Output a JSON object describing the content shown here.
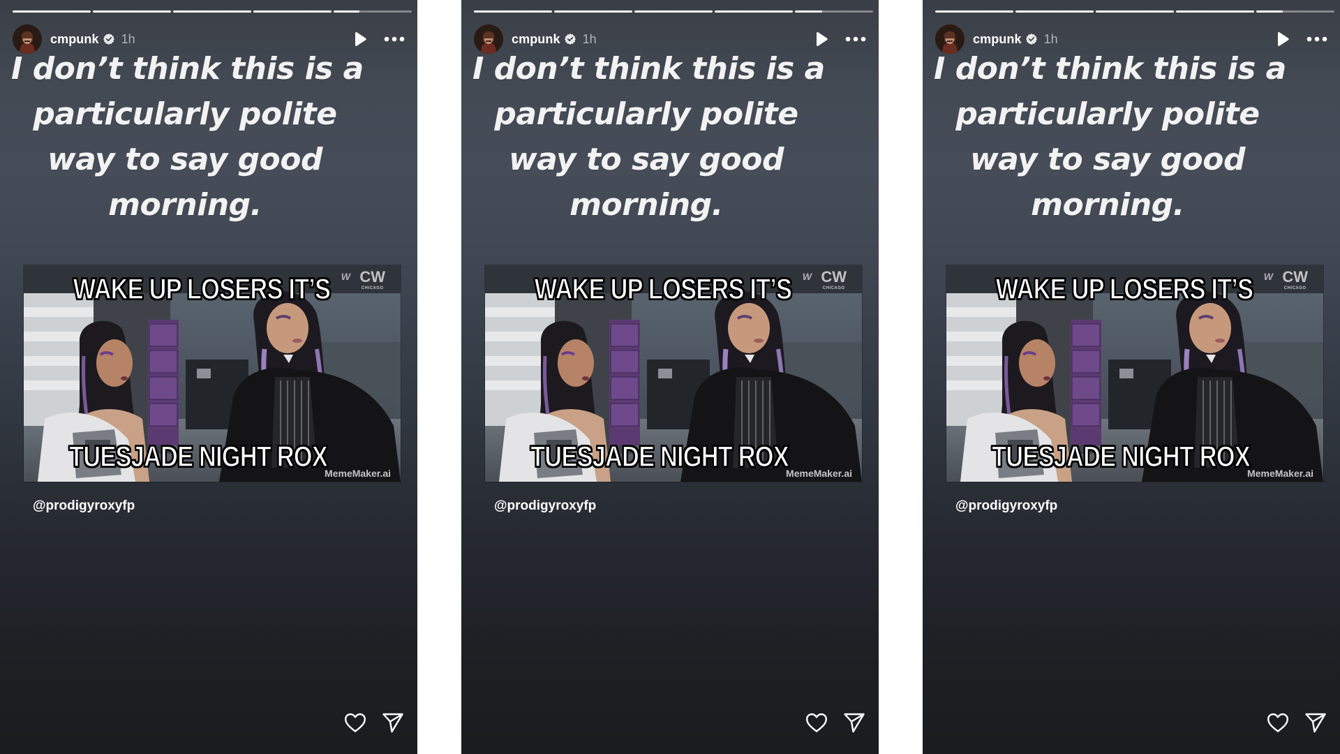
{
  "stories": [
    {
      "progress": {
        "segments": 5,
        "completed_segments": 4,
        "current_segment_fraction": 0.33
      },
      "header": {
        "username": "cmpunk",
        "verified": true,
        "time_ago": "1h",
        "avatar_icon": "profile-photo",
        "play_icon": "play-icon",
        "more_icon": "more-horizontal-icon"
      },
      "headline": {
        "lines": [
          "I don’t think this is a",
          "particularly polite",
          "way to say good",
          "morning."
        ]
      },
      "meme": {
        "top_caption": "WAKE UP LOSERS IT’S",
        "bottom_caption": "TUESJADE NIGHT ROX",
        "watermark": "MemeMaker.ai",
        "network_logo": "CW",
        "network_city": "CHICAGO",
        "wwe_logo": "W"
      },
      "mention": "@prodigyroxyfp",
      "actions": {
        "like_icon": "heart-icon",
        "share_icon": "send-icon"
      }
    },
    {
      "progress": {
        "segments": 5,
        "completed_segments": 4,
        "current_segment_fraction": 0.35
      },
      "header": {
        "username": "cmpunk",
        "verified": true,
        "time_ago": "1h",
        "avatar_icon": "profile-photo",
        "play_icon": "play-icon",
        "more_icon": "more-horizontal-icon"
      },
      "headline": {
        "lines": [
          "I don’t think this is a",
          "particularly polite",
          "way to say good",
          "morning."
        ]
      },
      "meme": {
        "top_caption": "WAKE UP LOSERS IT’S",
        "bottom_caption": "TUESJADE NIGHT ROX",
        "watermark": "MemeMaker.ai",
        "network_logo": "CW",
        "network_city": "CHICAGO",
        "wwe_logo": "W"
      },
      "mention": "@prodigyroxyfp",
      "actions": {
        "like_icon": "heart-icon",
        "share_icon": "send-icon"
      }
    },
    {
      "progress": {
        "segments": 5,
        "completed_segments": 4,
        "current_segment_fraction": 0.34
      },
      "header": {
        "username": "cmpunk",
        "verified": true,
        "time_ago": "1h",
        "avatar_icon": "profile-photo",
        "play_icon": "play-icon",
        "more_icon": "more-horizontal-icon"
      },
      "headline": {
        "lines": [
          "I don’t think this is a",
          "particularly polite",
          "way to say good",
          "morning."
        ]
      },
      "meme": {
        "top_caption": "WAKE UP LOSERS IT’S",
        "bottom_caption": "TUESJADE NIGHT ROX",
        "watermark": "MemeMaker.ai",
        "network_logo": "CW",
        "network_city": "CHICAGO",
        "wwe_logo": "W"
      },
      "mention": "@prodigyroxyfp",
      "actions": {
        "like_icon": "heart-icon",
        "share_icon": "send-icon"
      }
    }
  ],
  "colors": {
    "background_top": "#434a54",
    "background_bottom": "#1b1c1e",
    "page_gap": "#ffffff",
    "text": "#ffffff",
    "muted_text": "#9a9ea6",
    "progress_track": "#7d8188"
  }
}
